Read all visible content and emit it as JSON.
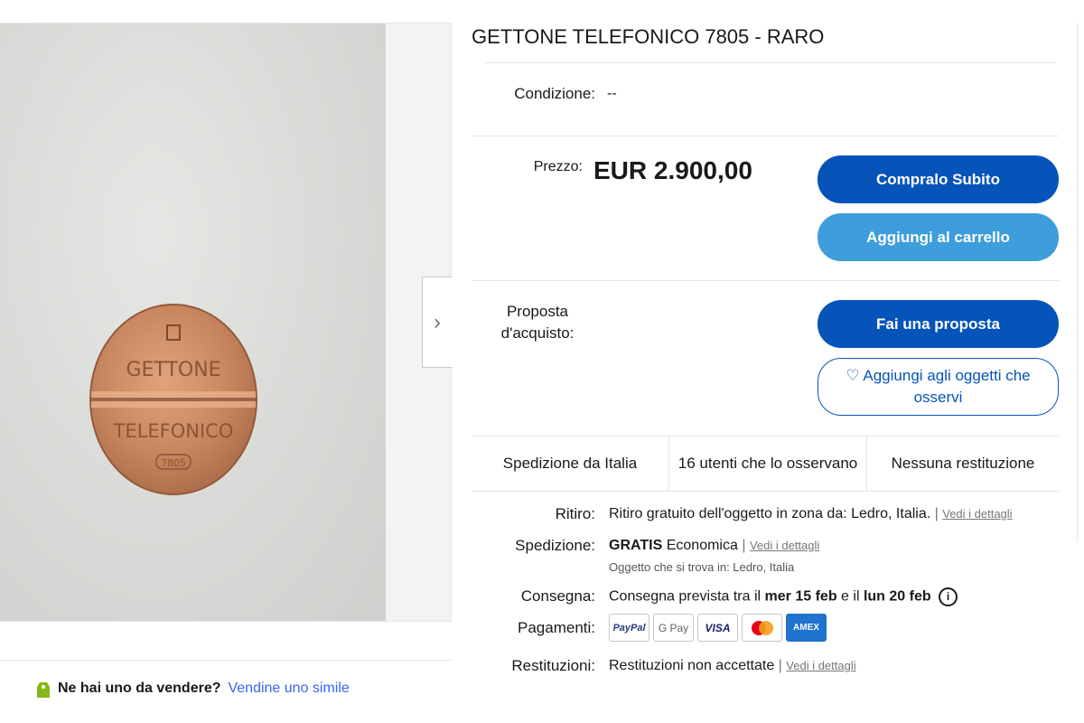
{
  "gallery": {
    "next_symbol": "›"
  },
  "coin": {
    "line1": "GETTONE",
    "line2": "TELEFONICO",
    "number": "7805"
  },
  "sell": {
    "question": "Ne hai uno da vendere?",
    "link": "Vendine uno simile"
  },
  "item": {
    "title": "GETTONE TELEFONICO 7805 - RARO",
    "condition_label": "Condizione:",
    "condition_value": "--",
    "price_label": "Prezzo:",
    "price": "EUR 2.900,00",
    "buy_now": "Compralo Subito",
    "add_cart": "Aggiungi al carrello",
    "offer_label": "Proposta d'acquisto:",
    "make_offer": "Fai una proposta",
    "watch": "♡ Aggiungi agli oggetti che osservi"
  },
  "stats": {
    "shipping_from": "Spedizione da Italia",
    "watchers": "16 utenti che lo osservano",
    "returns": "Nessuna restituzione"
  },
  "details": {
    "pickup_label": "Ritiro:",
    "pickup_value": "Ritiro gratuito dell'oggetto in zona da: Ledro, Italia.",
    "see_details": "Vedi i dettagli",
    "shipping_label": "Spedizione:",
    "shipping_free": "GRATIS",
    "shipping_type": "Economica",
    "shipping_location": "Oggetto che si trova in: Ledro, Italia",
    "delivery_label": "Consegna:",
    "delivery_prefix": "Consegna prevista tra il",
    "delivery_from": "mer 15 feb",
    "delivery_mid": "e il",
    "delivery_to": "lun 20 feb",
    "payments_label": "Pagamenti:",
    "payments": [
      "PayPal",
      "G Pay",
      "VISA",
      "Mastercard",
      "AMEX"
    ],
    "returns_label": "Restituzioni:",
    "returns_value": "Restituzioni non accettate",
    "separator": "|"
  },
  "colors": {
    "primary": "#0654ba",
    "secondary": "#3e9ddb",
    "link": "#3665f3",
    "coin": "#c8865f"
  }
}
